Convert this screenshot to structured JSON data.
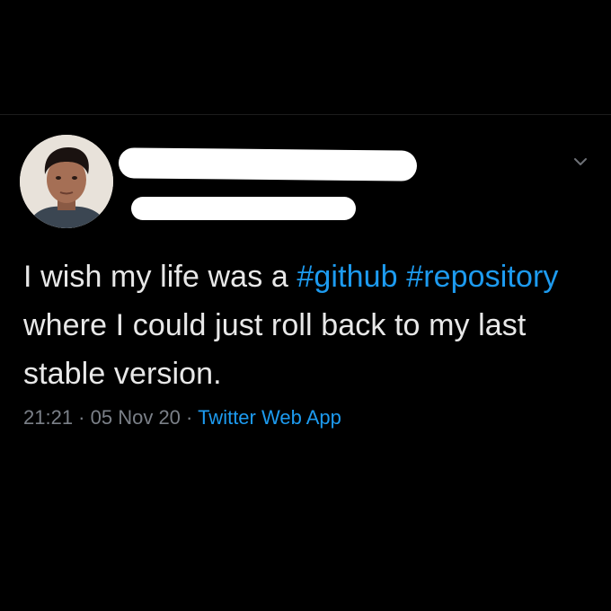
{
  "tweet": {
    "text_parts": {
      "p1": "I wish my life was a ",
      "hashtag1": "#github",
      "br": " ",
      "hashtag2": "#repository",
      "p2": " where I could just roll back to my last stable version."
    },
    "time": "21:21",
    "separator1": " · ",
    "date": "05 Nov 20",
    "separator2": " · ",
    "source": "Twitter Web App"
  },
  "icons": {
    "menu": "chevron-down-icon"
  },
  "colors": {
    "background": "#000000",
    "text": "#e8e8e8",
    "link": "#1d9bf0",
    "muted": "#7b8088"
  }
}
